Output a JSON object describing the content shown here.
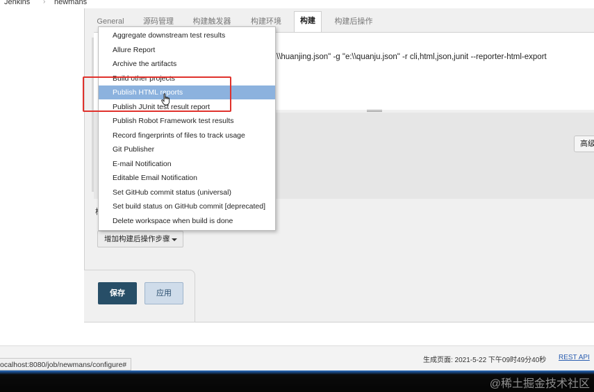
{
  "breadcrumb": [
    "Jenkins",
    "newmans"
  ],
  "tabs": [
    {
      "label": "General"
    },
    {
      "label": "源码管理"
    },
    {
      "label": "构建触发器"
    },
    {
      "label": "构建环境"
    },
    {
      "label": "构建"
    },
    {
      "label": "构建后操作"
    }
  ],
  "active_tab": "构建",
  "build": {
    "command_visible": "\\\\huanjing.json\" -g \"e:\\\\quanju.json\" -r cli,html,json,junit --reporter-html-export",
    "advanced_button": "高级"
  },
  "post_build": {
    "section_label": "构",
    "add_button": "增加构建后操作步骤"
  },
  "menu": {
    "items": [
      "Aggregate downstream test results",
      "Allure Report",
      "Archive the artifacts",
      "Build other projects",
      "Publish HTML reports",
      "Publish JUnit test result report",
      "Publish Robot Framework test results",
      "Record fingerprints of files to track usage",
      "Git Publisher",
      "E-mail Notification",
      "Editable Email Notification",
      "Set GitHub commit status (universal)",
      "Set build status on GitHub commit [deprecated]",
      "Delete workspace when build is done"
    ],
    "highlighted": "Publish HTML reports",
    "highlight_color": "#8cb2de",
    "annotation_color": "#e0312b"
  },
  "actions": {
    "save": "保存",
    "apply": "应用"
  },
  "footer": {
    "status_url": "ocalhost:8080/job/newmans/configure#",
    "generated": "生成页面: 2021-5-22 下午09时49分40秒",
    "rest_api": "REST API"
  },
  "watermark": "@稀土掘金技术社区"
}
